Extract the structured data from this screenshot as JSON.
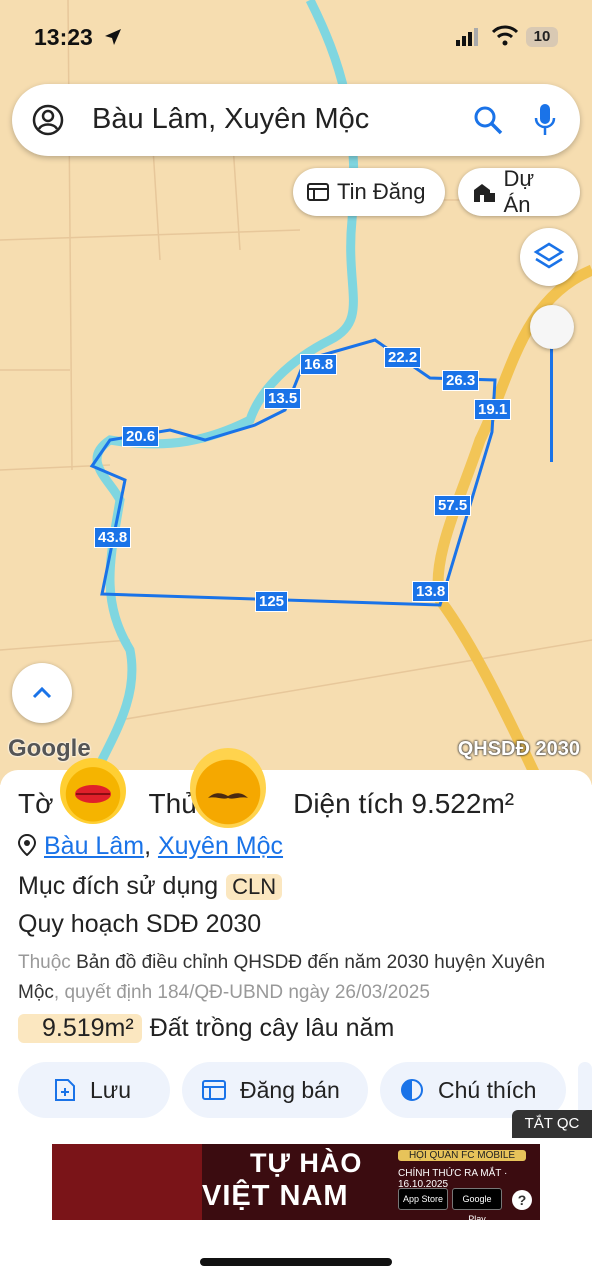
{
  "status": {
    "time": "13:23",
    "battery": "10"
  },
  "search": {
    "query": "Bàu Lâm, Xuyên Mộc"
  },
  "chips": {
    "listings": "Tin Đăng",
    "projects": "Dự Án"
  },
  "map": {
    "google": "Google",
    "overlay": "QHSDĐ 2030",
    "edge_labels": [
      "16.8",
      "22.2",
      "13.5",
      "26.3",
      "19.1",
      "20.6",
      "57.5",
      "43.8",
      "13.8",
      "125"
    ]
  },
  "parcel": {
    "sheet_label": "Tờ",
    "plot_label": "Thửa",
    "area_label": "Diện tích 9.522m²",
    "commune": "Bàu Lâm",
    "district": "Xuyên Mộc",
    "purpose_label": "Mục đích sử dụng",
    "purpose_code": "CLN",
    "plan_title": "Quy hoạch SDĐ 2030",
    "desc_prefix": "Thuộc",
    "desc_map": "Bản đồ điều chỉnh QHSDĐ đến năm 2030 huyện Xuyên Mộc",
    "desc_decision": ", quyết định 184/QĐ-UBND ngày 26/03/2025",
    "land_area": "9.519m²",
    "land_type": "Đất trồng cây lâu năm"
  },
  "actions": {
    "save": "Lưu",
    "post": "Đăng bán",
    "legend": "Chú thích"
  },
  "ad": {
    "close_label": "TẮT QC",
    "headline1": "TỰ HÀO",
    "headline2": "VIỆT NAM",
    "badge": "HỘI QUÂN FC MOBILE",
    "launch": "CHÍNH THỨC RA MẮT · 16.10.2025",
    "app_store": "App Store",
    "google_play": "Google Play"
  },
  "colors": {
    "accent": "#1a73e8",
    "map_bg": "#f6ddb0",
    "river": "#7fd6e0",
    "road": "#f2c24f"
  }
}
